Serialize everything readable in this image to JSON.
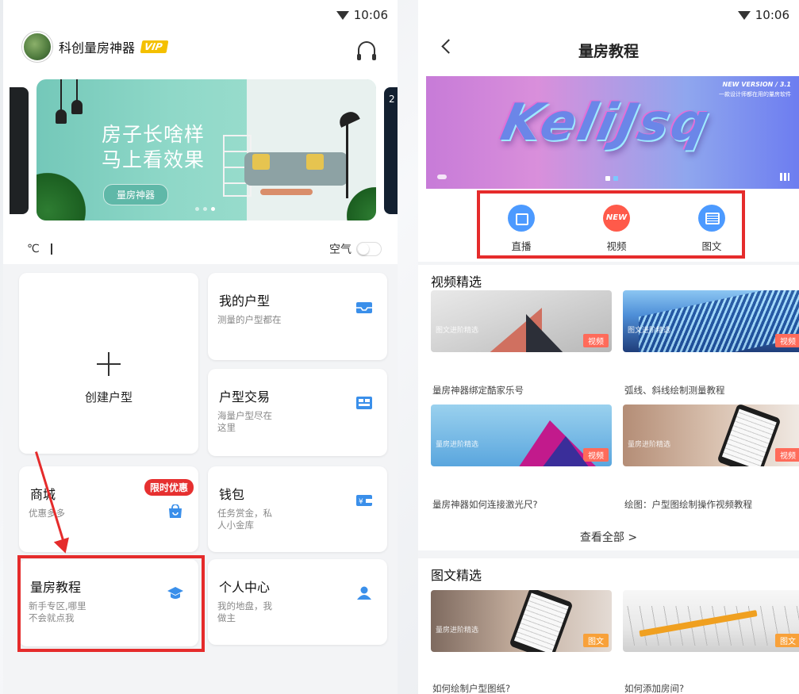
{
  "status": {
    "time": "10:06"
  },
  "left": {
    "user": {
      "name": "科创量房神器",
      "vip": "VIP"
    },
    "banner": {
      "line1": "房子长啥样",
      "line2": "马上看效果",
      "button": "量房神器",
      "side_text": "2"
    },
    "weather": {
      "unit": "℃",
      "air_label": "空气"
    },
    "cards": {
      "create": {
        "label": "创建户型"
      },
      "my_plan": {
        "title": "我的户型",
        "sub": "测量的户型都在"
      },
      "trade": {
        "title": "户型交易",
        "sub": "海量户型尽在这里"
      },
      "mall": {
        "title": "商城",
        "sub": "优惠多多",
        "badge": "限时优惠"
      },
      "wallet": {
        "title": "钱包",
        "sub": "任务赏金，私人小金库"
      },
      "tutorial": {
        "title": "量房教程",
        "sub": "新手专区,哪里不会就点我"
      },
      "profile": {
        "title": "个人中心",
        "sub": "我的地盘，我做主"
      }
    },
    "colors": {
      "highlight": "#e52b2b",
      "icon_blue": "#3a8fea"
    }
  },
  "right": {
    "title": "量房教程",
    "hero": {
      "word": "KeliJsq",
      "version": "NEW VERSION / 3.1",
      "subtitle": "一款设计师都在用的量房软件"
    },
    "categories": [
      {
        "label": "直播",
        "icon": "live-video-icon"
      },
      {
        "label": "视频",
        "icon": "new-badge-icon",
        "badge": "NEW"
      },
      {
        "label": "图文",
        "icon": "article-icon"
      }
    ],
    "video_section": {
      "title": "视频精选",
      "items": [
        {
          "title": "量房神器绑定酷家乐号",
          "tag": "视频",
          "thumb_label": "图文进阶精选"
        },
        {
          "title": "弧线、斜线绘制测量教程",
          "tag": "视频",
          "thumb_label": "图文进阶精选"
        },
        {
          "title": "量房神器如何连接激光尺?",
          "tag": "视频",
          "thumb_label": "量房进阶精选"
        },
        {
          "title": "绘图：户型图绘制操作视频教程",
          "tag": "视频",
          "thumb_label": "量房进阶精选"
        }
      ],
      "see_all": "查看全部 >"
    },
    "article_section": {
      "title": "图文精选",
      "items": [
        {
          "title": "如何绘制户型图纸?",
          "tag": "图文",
          "thumb_label": "量房进阶精选"
        },
        {
          "title": "如何添加房间?",
          "tag": "图文",
          "thumb_label": ""
        }
      ]
    }
  }
}
